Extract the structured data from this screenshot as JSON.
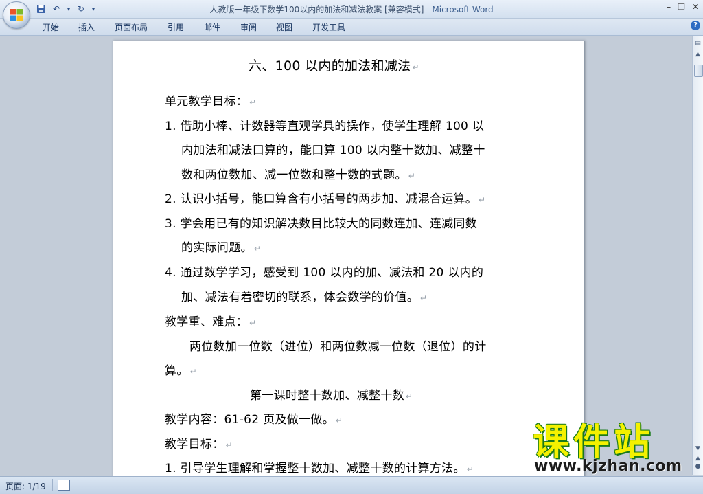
{
  "window": {
    "title_doc": "人教版一年级下数学100以内的加法和减法教案 [兼容模式]",
    "title_sep": " - ",
    "title_app": "Microsoft Word",
    "controls": [
      "–",
      "❐",
      "✕"
    ]
  },
  "ribbon": {
    "tabs": [
      "开始",
      "插入",
      "页面布局",
      "引用",
      "邮件",
      "审阅",
      "视图",
      "开发工具"
    ]
  },
  "document": {
    "lines": [
      "六、100 以内的加法和减法",
      "单元教学目标：",
      "1. 借助小棒、计数器等直观学具的操作，使学生理解 100 以",
      "内加法和减法口算的，能口算 100 以内整十数加、减整十",
      "数和两位数加、减一位数和整十数的式题。",
      "2. 认识小括号，能口算含有小括号的两步加、减混合运算。",
      "3. 学会用已有的知识解决数目比较大的同数连加、连减同数",
      "的实际问题。",
      "4. 通过数学学习，感受到 100 以内的加、减法和 20 以内的",
      "加、减法有着密切的联系，体会数学的价值。",
      "教学重、难点：",
      "两位数加一位数（进位）和两位数减一位数（退位）的计",
      "算。",
      "第一课时整十数加、减整十数",
      "教学内容：61-62 页及做一做。",
      "教学目标：",
      "1. 引导学生理解和掌握整十数加、减整十数的计算方法。"
    ],
    "paragraph_mark": "↵"
  },
  "statusbar": {
    "page_info": "页面: 1/19"
  },
  "watermark": {
    "brand": "课件站",
    "url": "www.kjzhan.com"
  }
}
